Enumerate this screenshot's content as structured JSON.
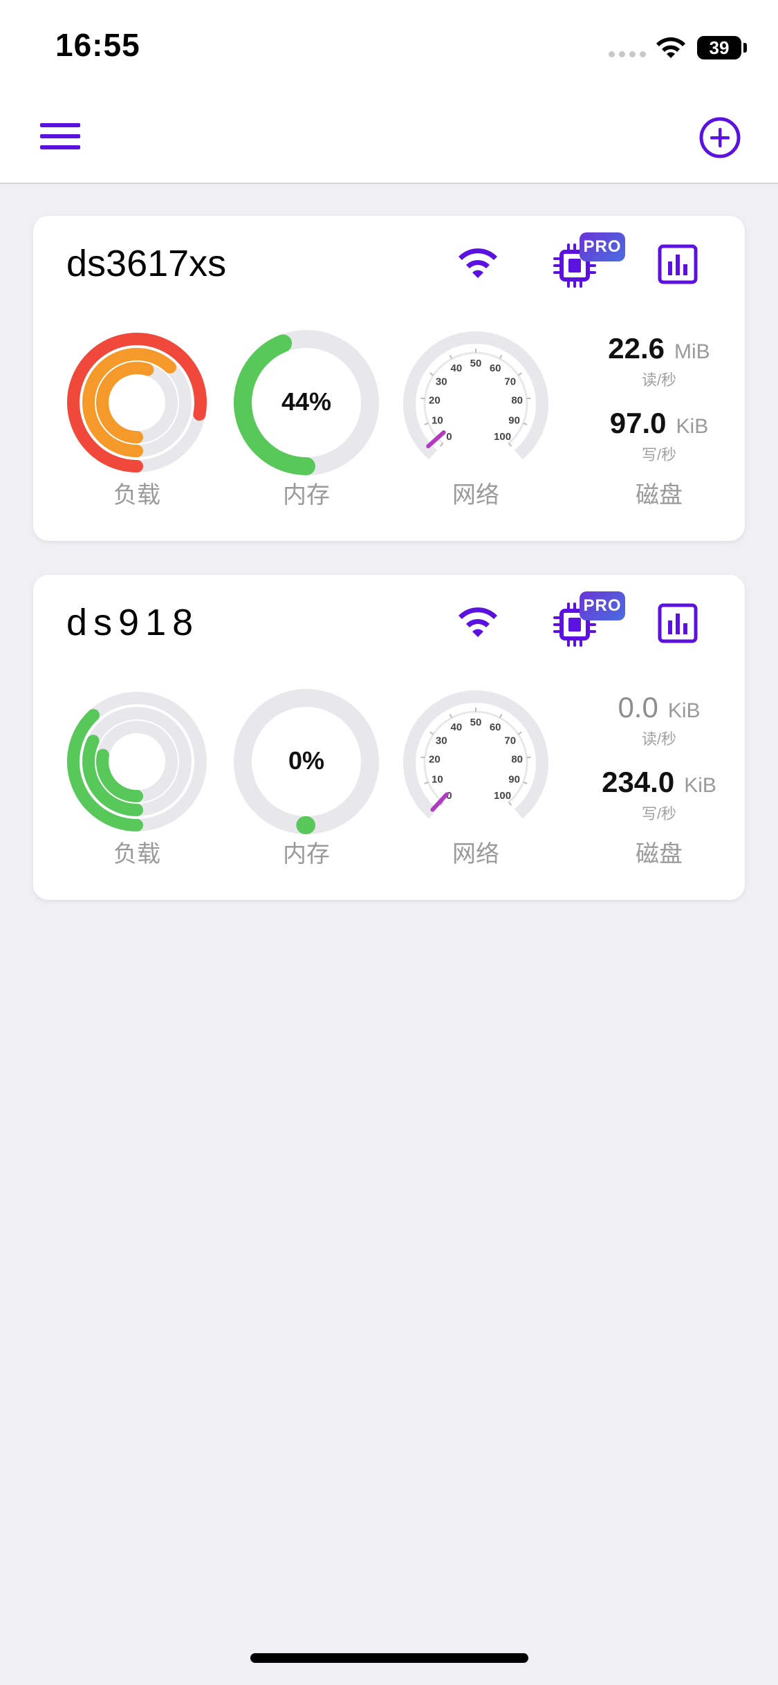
{
  "status_bar": {
    "time": "16:55",
    "battery": "39"
  },
  "nav": {
    "menu_icon": "hamburger-menu-icon",
    "add_icon": "plus-circle-icon"
  },
  "colors": {
    "accent": "#5b12e0",
    "red": "#f0483a",
    "orange": "#f59a2a",
    "green": "#59c85a",
    "track": "#e8e8ec",
    "pro_start": "#6a34d6",
    "pro_end": "#4a6ee0"
  },
  "servers": [
    {
      "name": "ds3617xs",
      "pro_badge": "PRO",
      "load_label": "负载",
      "memory_label": "内存",
      "network_label": "网络",
      "disk_label": "磁盘",
      "memory_percent_text": "44%",
      "memory_percent": 0.44,
      "load_rings": [
        {
          "color": "#f0483a",
          "fraction": 0.78
        },
        {
          "color": "#f59a2a",
          "fraction": 0.62
        },
        {
          "color": "#f59a2a",
          "fraction": 0.55
        }
      ],
      "network_needle_value": 3,
      "network_scale": [
        "0",
        "10",
        "20",
        "30",
        "40",
        "50",
        "60",
        "70",
        "80",
        "90",
        "100"
      ],
      "disk_read_value": "22.6",
      "disk_read_unit": "MiB",
      "disk_read_label": "读/秒",
      "disk_write_value": "97.0",
      "disk_write_unit": "KiB",
      "disk_write_label": "写/秒"
    },
    {
      "name": "ds918",
      "pro_badge": "PRO",
      "load_label": "负载",
      "memory_label": "内存",
      "network_label": "网络",
      "disk_label": "磁盘",
      "memory_percent_text": "0%",
      "memory_percent": 0.0,
      "load_rings": [
        {
          "color": "#59c85a",
          "fraction": 0.38
        },
        {
          "color": "#59c85a",
          "fraction": 0.32
        },
        {
          "color": "#59c85a",
          "fraction": 0.28
        }
      ],
      "network_needle_value": 1,
      "network_scale": [
        "0",
        "10",
        "20",
        "30",
        "40",
        "50",
        "60",
        "70",
        "80",
        "90",
        "100"
      ],
      "disk_read_value": "0.0",
      "disk_read_unit": "KiB",
      "disk_read_label": "读/秒",
      "disk_write_value": "234.0",
      "disk_write_unit": "KiB",
      "disk_write_label": "写/秒"
    }
  ]
}
